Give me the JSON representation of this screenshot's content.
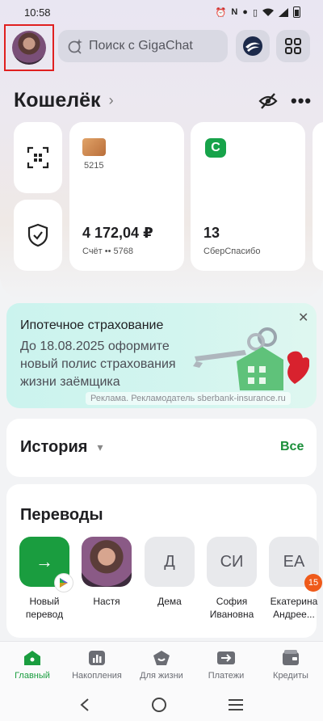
{
  "status": {
    "time": "10:58",
    "icons": [
      "alarm-icon",
      "nfc-icon",
      "location-icon",
      "vibrate-icon",
      "wifi-icon",
      "signal-icon",
      "battery-icon"
    ]
  },
  "header": {
    "search_placeholder": "Поиск с GigaChat",
    "icons": [
      "profile-avatar",
      "gigachat-icon",
      "sber-assistant-icon",
      "apps-grid-icon"
    ]
  },
  "wallet": {
    "title": "Кошелёк",
    "account": {
      "card_last": "5215",
      "amount": "4 172,04 ₽",
      "label": "Счёт •• 5768"
    },
    "bonus": {
      "logo": "С",
      "amount": "13",
      "label": "СберСпасибо"
    }
  },
  "ad": {
    "title": "Ипотечное страхование",
    "text": "До 18.08.2025 оформите новый полис страхования жизни заёмщика",
    "disclaimer": "Реклама. Рекламодатель sberbank-insurance.ru",
    "close": "✕"
  },
  "history": {
    "title": "История",
    "all_label": "Все"
  },
  "transfers": {
    "title": "Переводы",
    "contacts": [
      {
        "initials": "→",
        "name": "Новый перевод"
      },
      {
        "initials": "",
        "name": "Настя"
      },
      {
        "initials": "Д",
        "name": "Дема"
      },
      {
        "initials": "СИ",
        "name": "София Ивановна"
      },
      {
        "initials": "ЕА",
        "name": "Екатерина Андрее...",
        "badge": "15"
      }
    ]
  },
  "nav": {
    "items": [
      {
        "label": "Главный",
        "icon": "home-icon"
      },
      {
        "label": "Накопления",
        "icon": "savings-icon"
      },
      {
        "label": "Для жизни",
        "icon": "lifestyle-icon"
      },
      {
        "label": "Платежи",
        "icon": "payments-icon"
      },
      {
        "label": "Кредиты",
        "icon": "credits-icon"
      }
    ]
  },
  "colors": {
    "accent": "#1a9d3f",
    "badge": "#ef5a1a",
    "highlight_box": "#e02020"
  }
}
